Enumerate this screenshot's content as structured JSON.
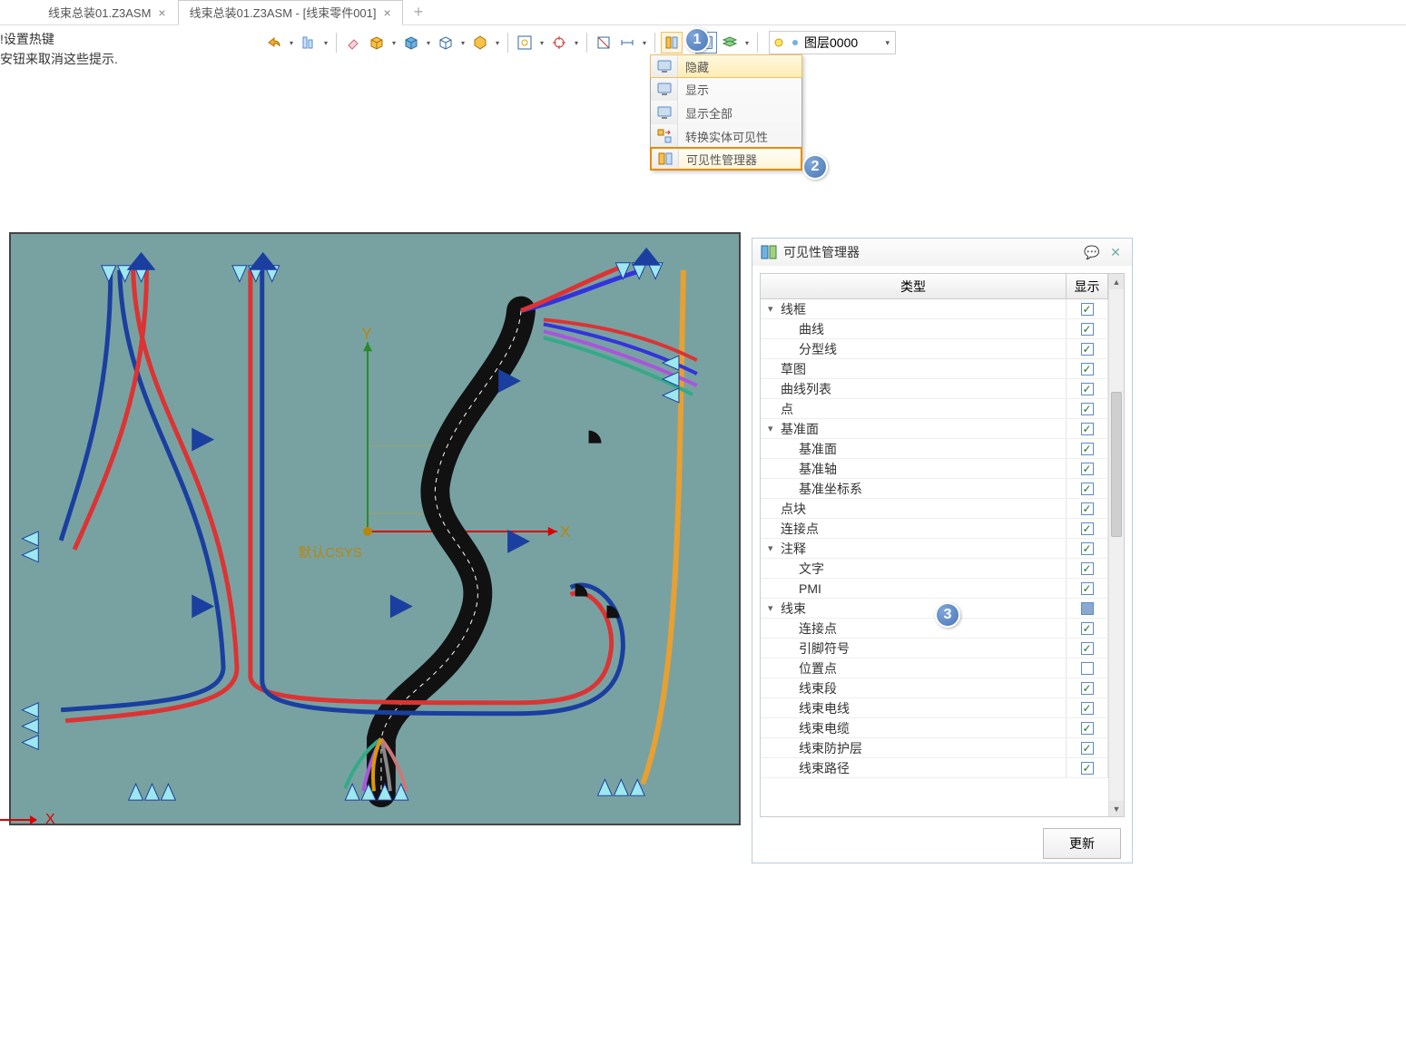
{
  "tabs": {
    "items": [
      {
        "label": "线束总装01.Z3ASM"
      },
      {
        "label": "线束总装01.Z3ASM - [线束零件001]"
      }
    ]
  },
  "hints": {
    "line1": "!设置热键",
    "line2": "安钮来取消这些提示."
  },
  "layer": {
    "label": "图层0000"
  },
  "dropdown": {
    "items": [
      {
        "label": "隐藏"
      },
      {
        "label": "显示"
      },
      {
        "label": "显示全部"
      },
      {
        "label": "转换实体可见性"
      },
      {
        "label": "可见性管理器"
      }
    ]
  },
  "callouts": {
    "c1": "1",
    "c2": "2",
    "c3": "3"
  },
  "viewport": {
    "csys_label": "默认CSYS",
    "axis_x": "X",
    "axis_y": "Y",
    "axis_bottom": "X"
  },
  "panel": {
    "title": "可见性管理器",
    "header_type": "类型",
    "header_show": "显示",
    "rows": [
      {
        "label": "线框",
        "level": 0,
        "exp": true,
        "chk": "on"
      },
      {
        "label": "曲线",
        "level": 1,
        "chk": "on"
      },
      {
        "label": "分型线",
        "level": 1,
        "chk": "on"
      },
      {
        "label": "草图",
        "level": 0,
        "chk": "on"
      },
      {
        "label": "曲线列表",
        "level": 0,
        "chk": "on"
      },
      {
        "label": "点",
        "level": 0,
        "chk": "on"
      },
      {
        "label": "基准面",
        "level": 0,
        "exp": true,
        "chk": "on"
      },
      {
        "label": "基准面",
        "level": 1,
        "chk": "on"
      },
      {
        "label": "基准轴",
        "level": 1,
        "chk": "on"
      },
      {
        "label": "基准坐标系",
        "level": 1,
        "chk": "on"
      },
      {
        "label": "点块",
        "level": 0,
        "chk": "on"
      },
      {
        "label": "连接点",
        "level": 0,
        "chk": "on"
      },
      {
        "label": "注释",
        "level": 0,
        "exp": true,
        "chk": "on"
      },
      {
        "label": "文字",
        "level": 1,
        "chk": "on"
      },
      {
        "label": "PMI",
        "level": 1,
        "chk": "on"
      },
      {
        "label": "线束",
        "level": 0,
        "exp": true,
        "chk": "partial"
      },
      {
        "label": "连接点",
        "level": 1,
        "chk": "on"
      },
      {
        "label": "引脚符号",
        "level": 1,
        "chk": "on"
      },
      {
        "label": "位置点",
        "level": 1,
        "chk": "off"
      },
      {
        "label": "线束段",
        "level": 1,
        "chk": "on"
      },
      {
        "label": "线束电线",
        "level": 1,
        "chk": "on"
      },
      {
        "label": "线束电缆",
        "level": 1,
        "chk": "on"
      },
      {
        "label": "线束防护层",
        "level": 1,
        "chk": "on"
      },
      {
        "label": "线束路径",
        "level": 1,
        "chk": "on"
      }
    ],
    "update": "更新"
  }
}
